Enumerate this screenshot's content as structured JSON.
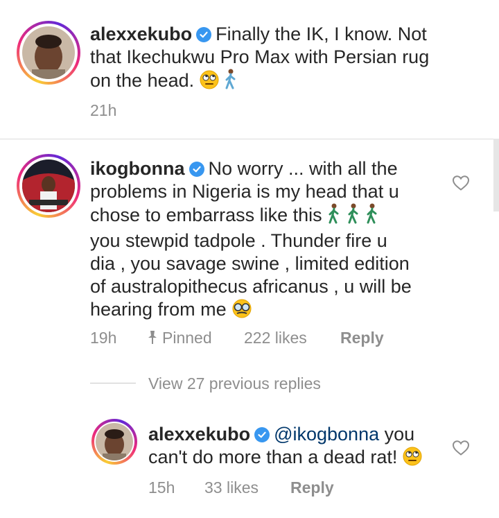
{
  "comments": [
    {
      "username": "alexxekubo",
      "verified": true,
      "text": "Finally the IK, I know. Not that Ikechukwu Pro Max with Persian rug on the head.",
      "lines": [
        "Finally the IK, I know. Not",
        "that Ikechukwu Pro Max with Persian rug",
        "on the head."
      ],
      "time": "21h",
      "emojis": [
        "rolling-eyes-icon",
        "walking-person-icon"
      ]
    },
    {
      "username": "ikogbonna",
      "verified": true,
      "lines": [
        "No worry ... with all the",
        "problems in Nigeria is my head that u",
        "chose to embarrass like this",
        "you stewpid tadpole . Thunder fire u",
        "dia , you savage swine , limited edition",
        "of australopithecus africanus , u will be",
        "hearing from me"
      ],
      "time": "19h",
      "pinned_label": "Pinned",
      "likes": "222 likes",
      "reply_label": "Reply",
      "emojis": [
        "walking-person-icon",
        "walking-person-icon",
        "walking-person-icon",
        "disguised-face-icon"
      ]
    }
  ],
  "view_replies": "View 27 previous replies",
  "reply": {
    "username": "alexxekubo",
    "verified": true,
    "mention": "@ikogbonna",
    "lines": [
      "you",
      "can't do more than a dead rat!"
    ],
    "time": "15h",
    "likes": "33 likes",
    "reply_label": "Reply",
    "emojis": [
      "rolling-eyes-icon"
    ]
  },
  "colors": {
    "text": "#262626",
    "meta": "#8e8e8e",
    "verified": "#3897f0",
    "mention": "#00376b",
    "divider": "#dbdbdb"
  }
}
